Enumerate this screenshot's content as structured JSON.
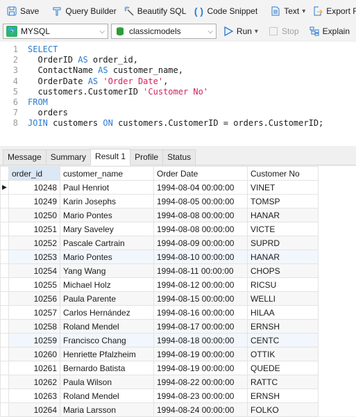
{
  "toolbar": {
    "save": "Save",
    "query_builder": "Query Builder",
    "beautify": "Beautify SQL",
    "code_snippet": "Code Snippet",
    "text": "Text",
    "export": "Export Re"
  },
  "bar2": {
    "connection": "MYSQL",
    "database": "classicmodels",
    "run": "Run",
    "stop": "Stop",
    "explain": "Explain"
  },
  "editor": {
    "lines": [
      {
        "n": "1"
      },
      {
        "n": "2"
      },
      {
        "n": "3"
      },
      {
        "n": "4"
      },
      {
        "n": "5"
      },
      {
        "n": "6"
      },
      {
        "n": "7"
      },
      {
        "n": "8"
      }
    ],
    "tokens": {
      "l1_kw": "SELECT",
      "l2_a": "  OrderID ",
      "l2_kw": "AS",
      "l2_b": " order_id,",
      "l3_a": "  ContactName ",
      "l3_kw": "AS",
      "l3_b": " customer_name,",
      "l4_a": "  OrderDate ",
      "l4_kw": "AS",
      "l4_str": " 'Order Date'",
      "l4_b": ",",
      "l5_a": "  customers.CustomerID ",
      "l5_str": "'Customer No'",
      "l6_kw": "FROM",
      "l7_a": "  orders",
      "l8_kw1": "JOIN",
      "l8_a": " customers ",
      "l8_kw2": "ON",
      "l8_b": " customers.CustomerID = orders.CustomerID;"
    }
  },
  "tabs": [
    "Message",
    "Summary",
    "Result 1",
    "Profile",
    "Status"
  ],
  "grid": {
    "columns": [
      "order_id",
      "customer_name",
      "Order Date",
      "Customer No"
    ],
    "rows": [
      [
        "10248",
        "Paul Henriot",
        "1994-08-04 00:00:00",
        "VINET"
      ],
      [
        "10249",
        "Karin Josephs",
        "1994-08-05 00:00:00",
        "TOMSP"
      ],
      [
        "10250",
        "Mario Pontes",
        "1994-08-08 00:00:00",
        "HANAR"
      ],
      [
        "10251",
        "Mary Saveley",
        "1994-08-08 00:00:00",
        "VICTE"
      ],
      [
        "10252",
        "Pascale Cartrain",
        "1994-08-09 00:00:00",
        "SUPRD"
      ],
      [
        "10253",
        "Mario Pontes",
        "1994-08-10 00:00:00",
        "HANAR"
      ],
      [
        "10254",
        "Yang Wang",
        "1994-08-11 00:00:00",
        "CHOPS"
      ],
      [
        "10255",
        "Michael Holz",
        "1994-08-12 00:00:00",
        "RICSU"
      ],
      [
        "10256",
        "Paula Parente",
        "1994-08-15 00:00:00",
        "WELLI"
      ],
      [
        "10257",
        "Carlos Hernández",
        "1994-08-16 00:00:00",
        "HILAA"
      ],
      [
        "10258",
        "Roland Mendel",
        "1994-08-17 00:00:00",
        "ERNSH"
      ],
      [
        "10259",
        "Francisco Chang",
        "1994-08-18 00:00:00",
        "CENTC"
      ],
      [
        "10260",
        "Henriette Pfalzheim",
        "1994-08-19 00:00:00",
        "OTTIK"
      ],
      [
        "10261",
        "Bernardo Batista",
        "1994-08-19 00:00:00",
        "QUEDE"
      ],
      [
        "10262",
        "Paula Wilson",
        "1994-08-22 00:00:00",
        "RATTC"
      ],
      [
        "10263",
        "Roland Mendel",
        "1994-08-23 00:00:00",
        "ERNSH"
      ],
      [
        "10264",
        "Maria Larsson",
        "1994-08-24 00:00:00",
        "FOLKO"
      ]
    ]
  }
}
